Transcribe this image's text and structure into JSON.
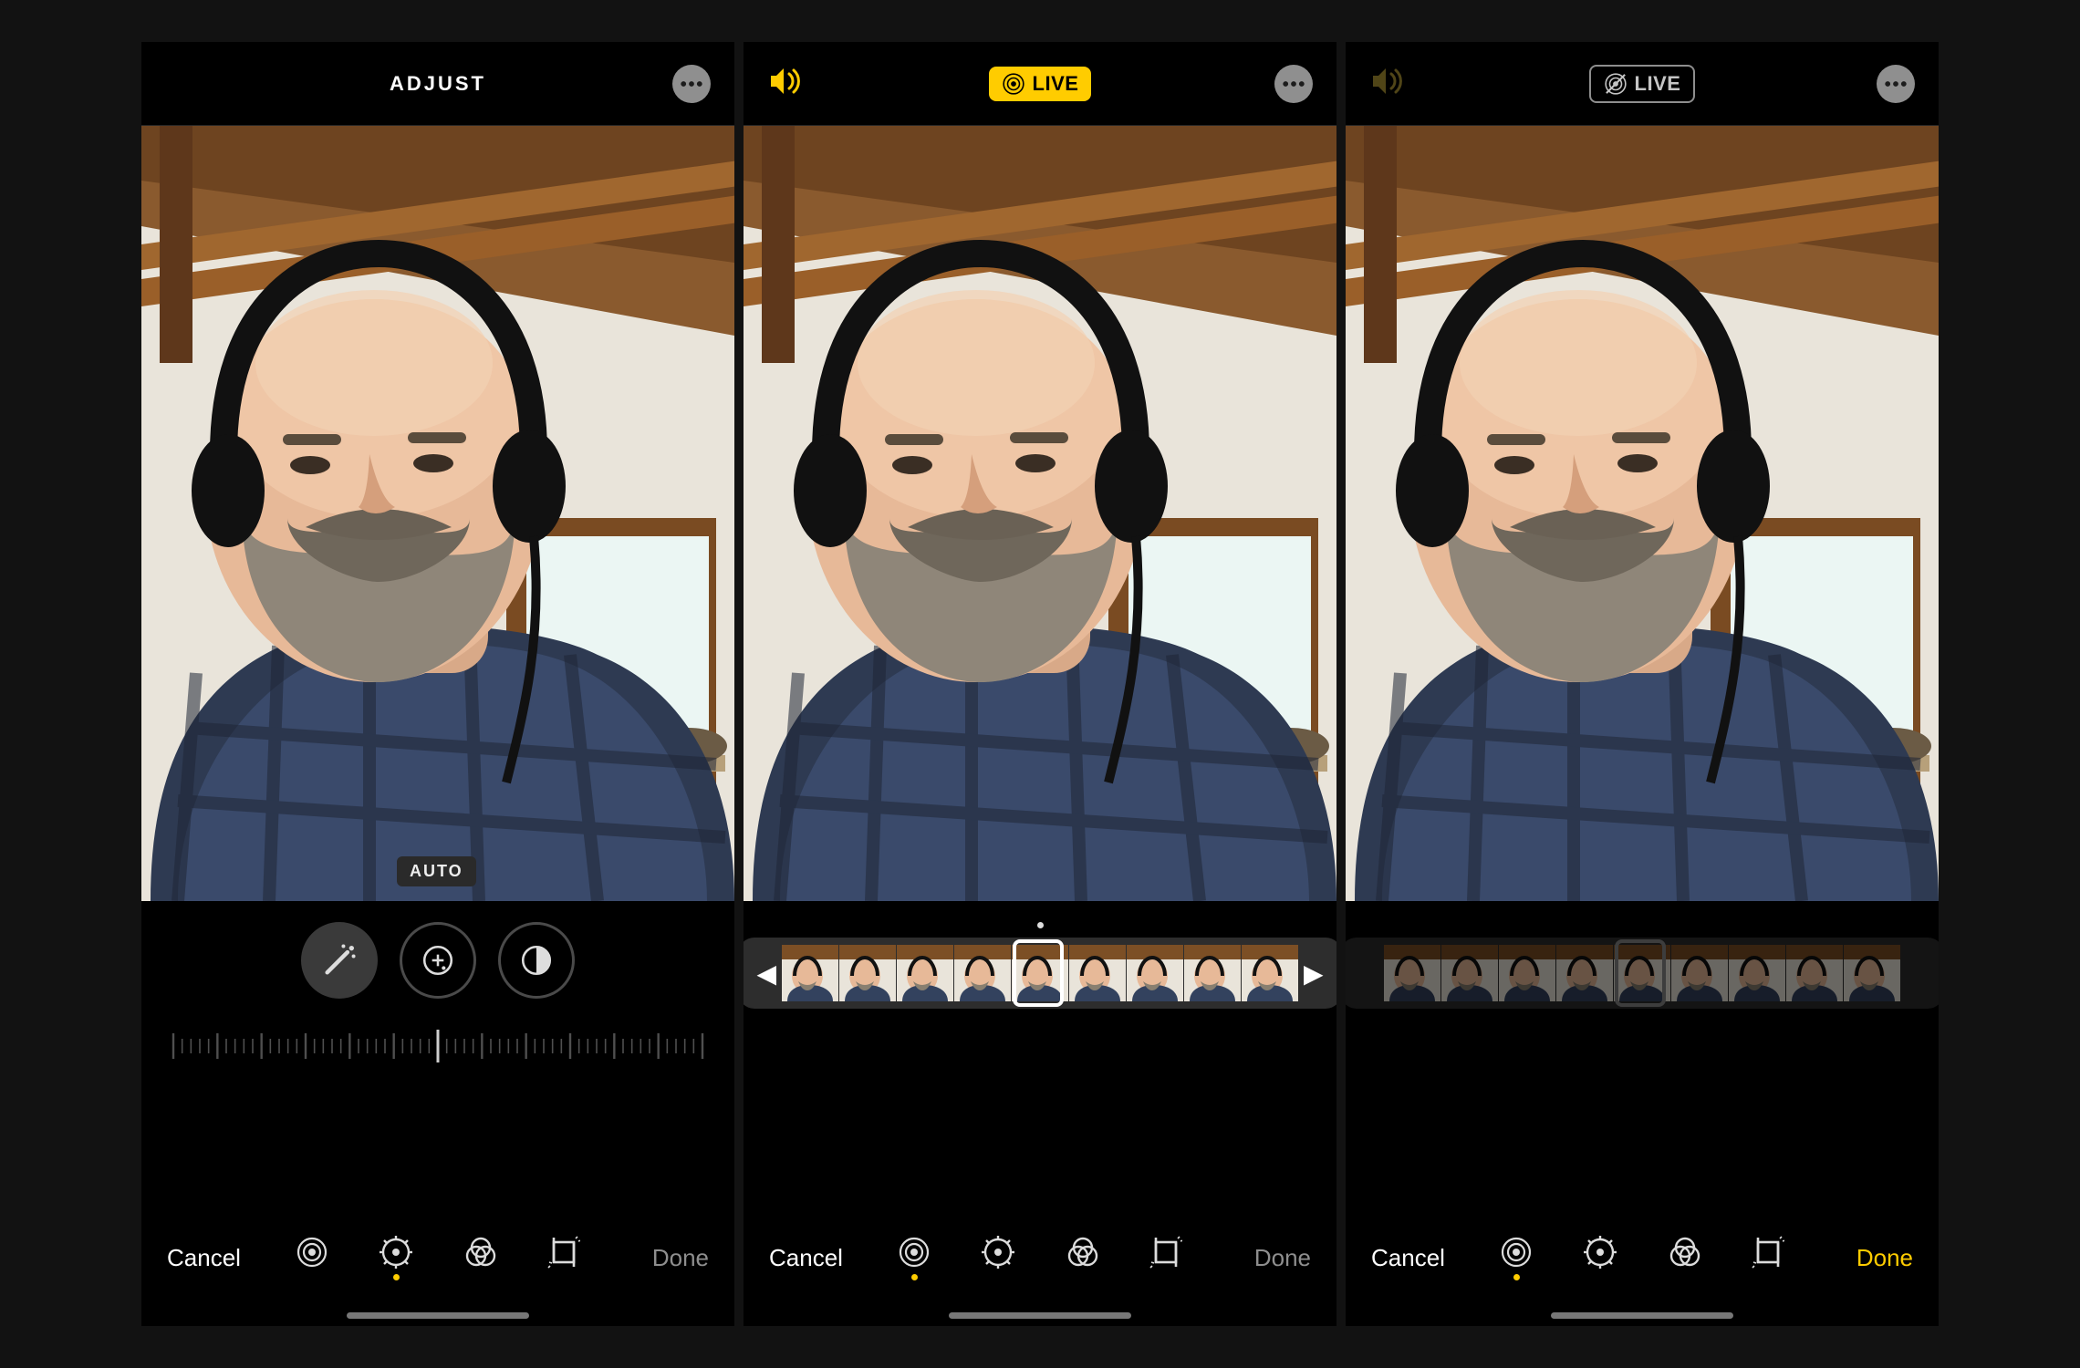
{
  "colors": {
    "accent": "#ffcc00",
    "bg": "#121212",
    "muted": "#8e8e8e"
  },
  "screens": [
    {
      "id": "adjust",
      "header": {
        "title": "ADJUST"
      },
      "photo_label": "AUTO",
      "adjust_tools": [
        "auto-wand",
        "exposure",
        "contrast"
      ],
      "toolbar": {
        "cancel": "Cancel",
        "done": "Done",
        "done_style": "muted",
        "active_tool": "adjust",
        "tools": [
          "live",
          "adjust",
          "filters",
          "crop"
        ]
      }
    },
    {
      "id": "live-on",
      "header": {
        "live_label": "LIVE",
        "live_state": "on",
        "sound": "on"
      },
      "filmstrip": {
        "frame_count": 9,
        "cursor_index": 4,
        "dim": false
      },
      "toolbar": {
        "cancel": "Cancel",
        "done": "Done",
        "done_style": "muted",
        "active_tool": "live",
        "tools": [
          "live",
          "adjust",
          "filters",
          "crop"
        ]
      }
    },
    {
      "id": "live-off",
      "header": {
        "live_label": "LIVE",
        "live_state": "off",
        "sound": "muted"
      },
      "filmstrip": {
        "frame_count": 9,
        "cursor_index": 4,
        "dim": true
      },
      "toolbar": {
        "cancel": "Cancel",
        "done": "Done",
        "done_style": "yellow",
        "active_tool": "live",
        "tools": [
          "live",
          "adjust",
          "filters",
          "crop"
        ]
      }
    }
  ]
}
